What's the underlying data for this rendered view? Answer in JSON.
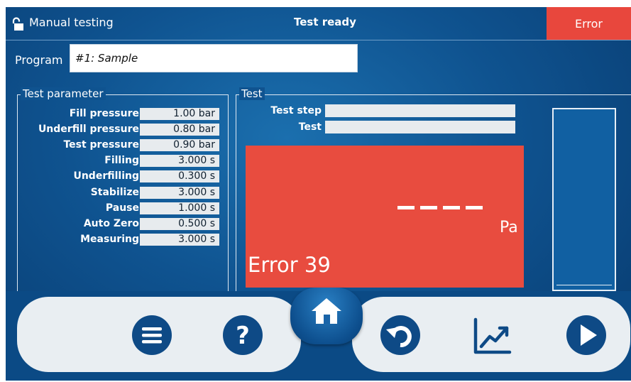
{
  "header": {
    "mode_title": "Manual testing",
    "status": "Test ready",
    "error_label": "Error",
    "lock_icon": "unlocked-padlock-icon"
  },
  "program": {
    "label": "Program",
    "value": "#1: Sample"
  },
  "test_parameter": {
    "title": "Test parameter",
    "rows": [
      {
        "label": "Fill pressure",
        "value": "1.00 bar"
      },
      {
        "label": "Underfill pressure",
        "value": "0.80 bar"
      },
      {
        "label": "Test pressure",
        "value": "0.90 bar"
      },
      {
        "label": "Filling",
        "value": "3.000 s"
      },
      {
        "label": "Underfilling",
        "value": "0.300 s"
      },
      {
        "label": "Stabilize",
        "value": "3.000 s"
      },
      {
        "label": "Pause",
        "value": "1.000 s"
      },
      {
        "label": "Auto Zero",
        "value": "0.500 s"
      },
      {
        "label": "Measuring",
        "value": "3.000 s"
      }
    ]
  },
  "test": {
    "title": "Test",
    "step_label": "Test step",
    "step_value": "",
    "test_label": "Test",
    "test_value": "",
    "unit": "Pa",
    "error_text": "Error 39",
    "reading_placeholder": "dashes",
    "gauge_level": 0
  },
  "nav": {
    "buttons": [
      "menu-icon",
      "help-icon",
      "home-icon",
      "undo-icon",
      "chart-icon",
      "play-icon"
    ]
  },
  "colors": {
    "error_red": "#e84c3f",
    "background_blue": "#0f5390",
    "icon_blue": "#0e4a86"
  }
}
